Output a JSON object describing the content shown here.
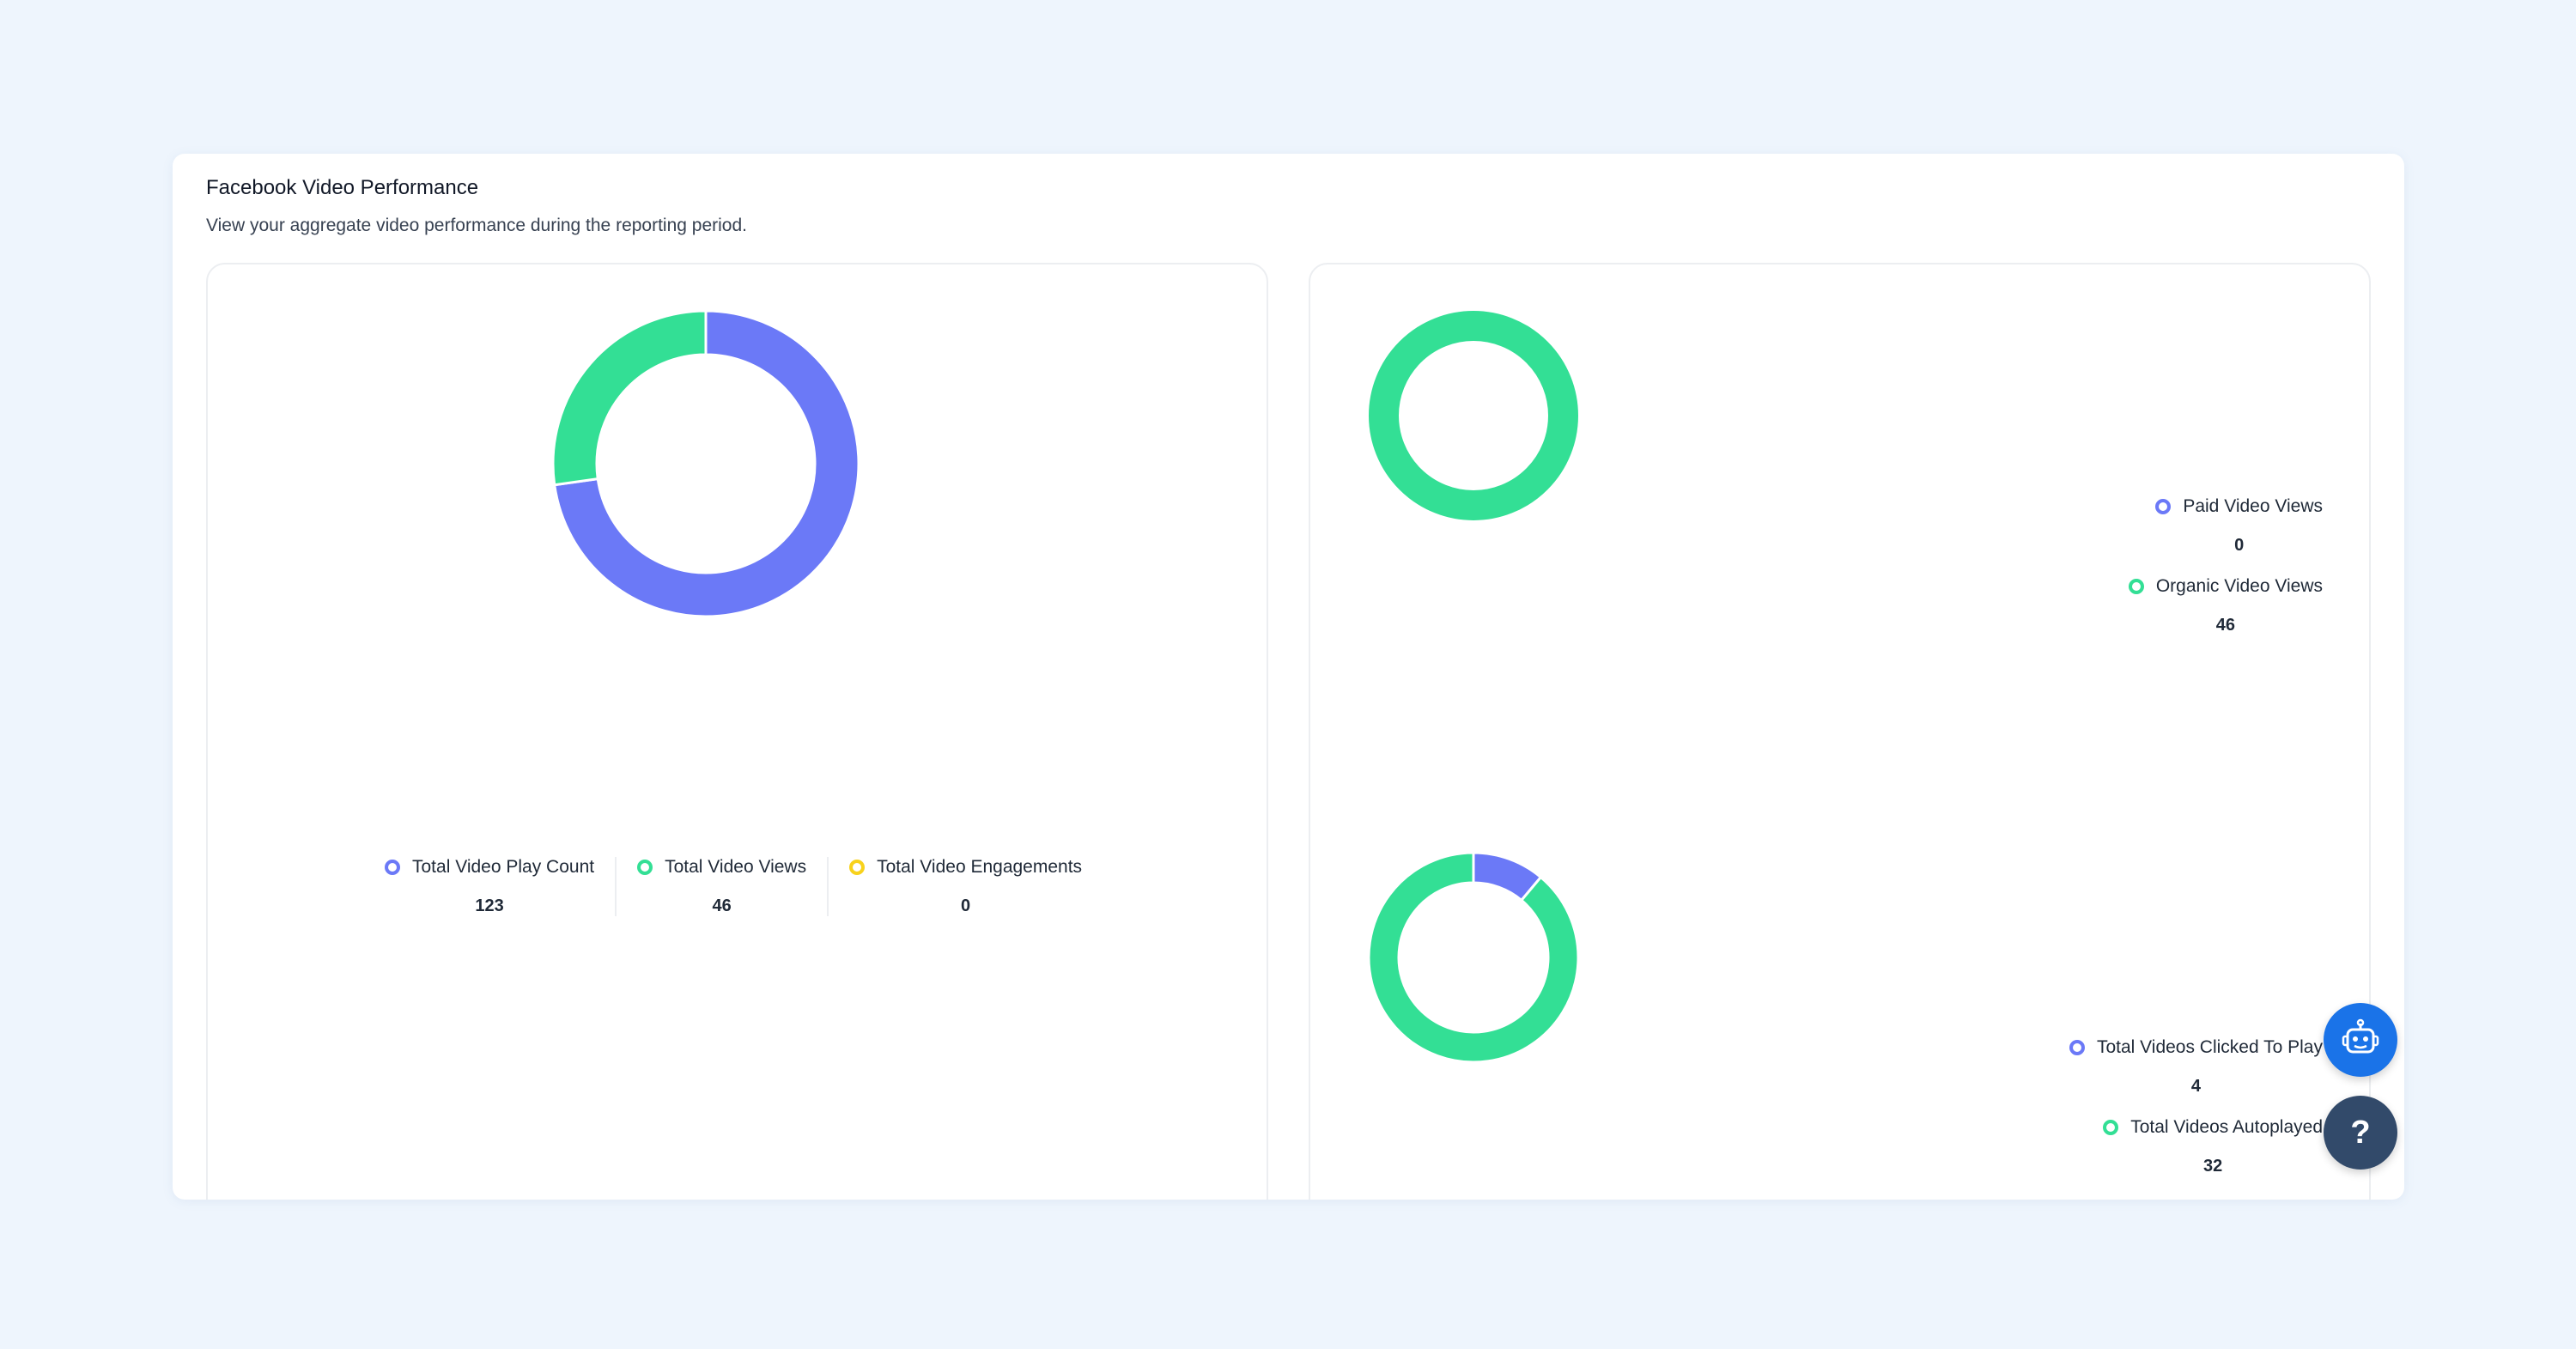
{
  "card": {
    "title": "Facebook Video Performance",
    "subtitle": "View your aggregate video performance during the reporting period."
  },
  "colors": {
    "blue": "#6b79f7",
    "green": "#33df95",
    "yellow": "#f8d21c",
    "page_bg": "#eef5fd"
  },
  "chart_data": [
    {
      "type": "pie",
      "variant": "donut",
      "categories": [
        "Total Video Play Count",
        "Total Video Views",
        "Total Video Engagements"
      ],
      "values": [
        123,
        46,
        0
      ],
      "colors": [
        "#6b79f7",
        "#33df95",
        "#f8d21c"
      ]
    },
    {
      "type": "pie",
      "variant": "donut",
      "categories": [
        "Paid Video Views",
        "Organic Video Views"
      ],
      "values": [
        0,
        46
      ],
      "colors": [
        "#6b79f7",
        "#33df95"
      ]
    },
    {
      "type": "pie",
      "variant": "donut",
      "categories": [
        "Total Videos Clicked To Play",
        "Total Videos Autoplayed"
      ],
      "values": [
        4,
        32
      ],
      "colors": [
        "#6b79f7",
        "#33df95"
      ]
    }
  ],
  "legend1": [
    {
      "label": "Total Video Play Count",
      "value": "123",
      "color": "#6b79f7"
    },
    {
      "label": "Total Video Views",
      "value": "46",
      "color": "#33df95"
    },
    {
      "label": "Total Video Engagements",
      "value": "0",
      "color": "#f8d21c"
    }
  ],
  "legend2": [
    {
      "label": "Paid Video Views",
      "value": "0",
      "color": "#6b79f7"
    },
    {
      "label": "Organic Video Views",
      "value": "46",
      "color": "#33df95"
    }
  ],
  "legend3": [
    {
      "label": "Total Videos Clicked To Play",
      "value": "4",
      "color": "#6b79f7"
    },
    {
      "label": "Total Videos Autoplayed",
      "value": "32",
      "color": "#33df95"
    }
  ],
  "help_button": {
    "label": "?",
    "icon": "question-icon"
  },
  "bot_button": {
    "icon": "robot-icon"
  }
}
